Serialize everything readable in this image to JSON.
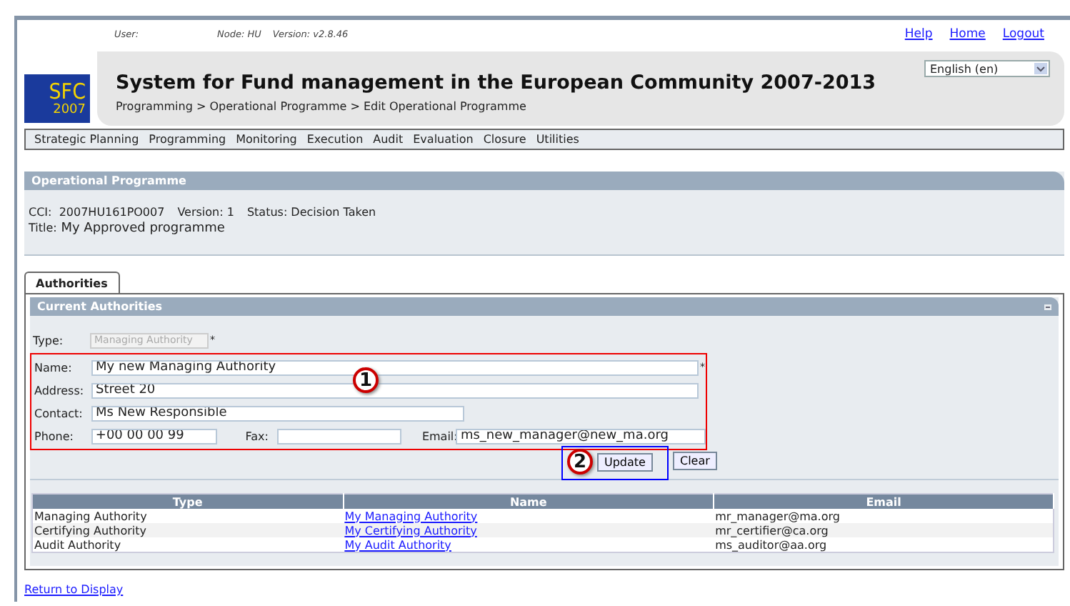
{
  "header": {
    "user_label": "User:",
    "node": "Node: HU",
    "version": "Version: v2.8.46",
    "links": [
      "Help",
      "Home",
      "Logout"
    ],
    "language": "English (en)",
    "logo": {
      "text": "SFC",
      "year": "2007"
    },
    "title": "System for Fund management in the European Community 2007-2013",
    "breadcrumb": "Programming > Operational Programme > Edit Operational Programme"
  },
  "menu": [
    "Strategic Planning",
    "Programming",
    "Monitoring",
    "Execution",
    "Audit",
    "Evaluation",
    "Closure",
    "Utilities"
  ],
  "programme_panel": {
    "title": "Operational Programme",
    "info": [
      "CCI:  2007HU161PO007",
      "Version: 1",
      "Status: Decision Taken"
    ],
    "title_label": "Title:",
    "title_value": "My Approved programme"
  },
  "tabs": [
    {
      "label": "Authorities",
      "selected": true
    }
  ],
  "authorities_panel": {
    "title": "Current Authorities",
    "type_field": {
      "label": "Type:",
      "value": "Managing Authority",
      "disabled": true,
      "required_mark": "*"
    },
    "name_field": {
      "label": "Name:",
      "value": "My new Managing Authority",
      "required_mark": "*"
    },
    "address_field": {
      "label": "Address:",
      "value": "Street 20"
    },
    "contact_field": {
      "label": "Contact:",
      "value": "Ms New Responsible"
    },
    "phone_field": {
      "label": "Phone:",
      "value": "+00 00 00 99"
    },
    "fax_field": {
      "label": "Fax:"
    },
    "email_field": {
      "label": "Email:",
      "value": "ms_new_manager@new_ma.org"
    },
    "buttons": [
      "Update",
      "Clear"
    ],
    "callouts": [
      "1",
      "2"
    ],
    "table": {
      "columns": [
        "Type",
        "Name",
        "Email"
      ],
      "rows": [
        [
          "Managing Authority",
          "My Managing Authority",
          "mr_manager@ma.org"
        ],
        [
          "Certifying Authority",
          "My Certifying Authority",
          "mr_certifier@ca.org"
        ],
        [
          "Audit Authority",
          "My Audit Authority",
          "ms_auditor@aa.org"
        ]
      ]
    }
  },
  "footer_link": "Return to Display"
}
